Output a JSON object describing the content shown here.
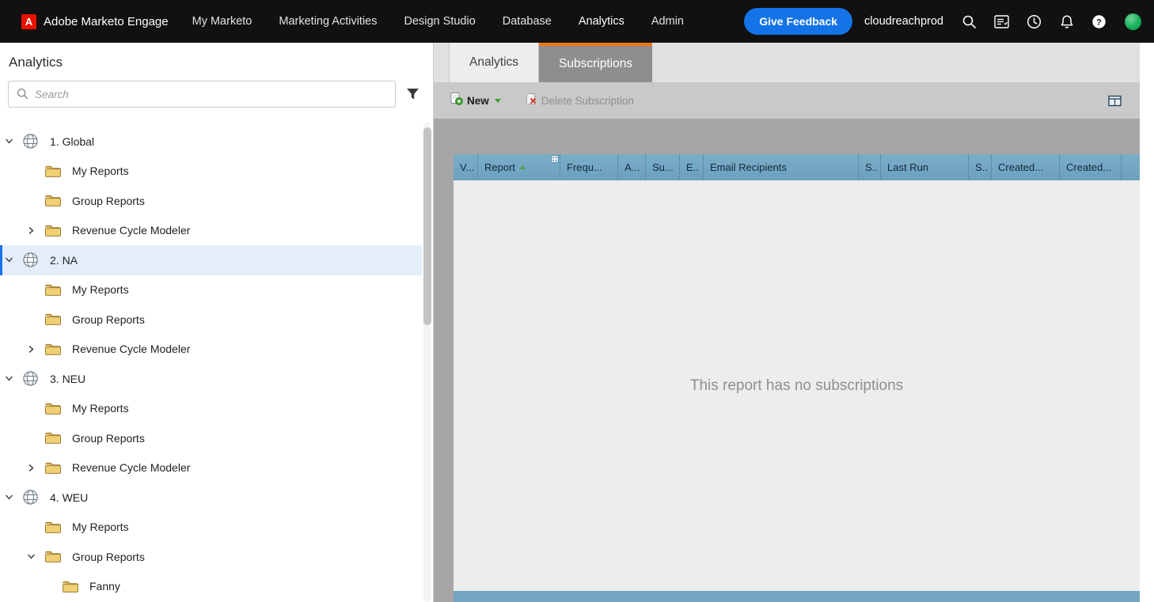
{
  "topbar": {
    "brand": "Adobe Marketo Engage",
    "nav": [
      {
        "label": "My Marketo",
        "active": false
      },
      {
        "label": "Marketing Activities",
        "active": false
      },
      {
        "label": "Design Studio",
        "active": false
      },
      {
        "label": "Database",
        "active": false
      },
      {
        "label": "Analytics",
        "active": true
      },
      {
        "label": "Admin",
        "active": false
      }
    ],
    "feedback_button": "Give Feedback",
    "account_name": "cloudreachprod",
    "icons": [
      "adobe-logo-icon",
      "search-icon",
      "form-icon",
      "clock-icon",
      "bell-icon",
      "help-icon",
      "avatar"
    ]
  },
  "sidebar": {
    "title": "Analytics",
    "search": {
      "placeholder": "Search"
    },
    "tree": [
      {
        "label": "1. Global",
        "icon": "workspace",
        "depth": 0,
        "state": "expanded",
        "selected": false
      },
      {
        "label": "My Reports",
        "icon": "folder",
        "depth": 1,
        "state": "none",
        "selected": false
      },
      {
        "label": "Group Reports",
        "icon": "folder",
        "depth": 1,
        "state": "none",
        "selected": false
      },
      {
        "label": "Revenue Cycle Modeler",
        "icon": "folder",
        "depth": 1,
        "state": "collapsed",
        "selected": false
      },
      {
        "label": "2. NA",
        "icon": "workspace",
        "depth": 0,
        "state": "expanded",
        "selected": true
      },
      {
        "label": "My Reports",
        "icon": "folder",
        "depth": 1,
        "state": "none",
        "selected": false
      },
      {
        "label": "Group Reports",
        "icon": "folder",
        "depth": 1,
        "state": "none",
        "selected": false
      },
      {
        "label": "Revenue Cycle Modeler",
        "icon": "folder",
        "depth": 1,
        "state": "collapsed",
        "selected": false
      },
      {
        "label": "3. NEU",
        "icon": "workspace",
        "depth": 0,
        "state": "expanded",
        "selected": false
      },
      {
        "label": "My Reports",
        "icon": "folder",
        "depth": 1,
        "state": "none",
        "selected": false
      },
      {
        "label": "Group Reports",
        "icon": "folder",
        "depth": 1,
        "state": "none",
        "selected": false
      },
      {
        "label": "Revenue Cycle Modeler",
        "icon": "folder",
        "depth": 1,
        "state": "collapsed",
        "selected": false
      },
      {
        "label": "4. WEU",
        "icon": "workspace",
        "depth": 0,
        "state": "expanded",
        "selected": false
      },
      {
        "label": "My Reports",
        "icon": "folder",
        "depth": 1,
        "state": "none",
        "selected": false
      },
      {
        "label": "Group Reports",
        "icon": "folder",
        "depth": 1,
        "state": "expanded",
        "selected": false
      },
      {
        "label": "Fanny",
        "icon": "folder",
        "depth": 2,
        "state": "none",
        "selected": false
      }
    ]
  },
  "main": {
    "tabs": [
      {
        "label": "Analytics",
        "active": false
      },
      {
        "label": "Subscriptions",
        "active": true
      }
    ],
    "toolbar": {
      "new_label": "New",
      "delete_label": "Delete Subscription",
      "delete_enabled": false
    },
    "table": {
      "columns": [
        {
          "label": "V..."
        },
        {
          "label": "Report",
          "sort": "asc",
          "menu": true
        },
        {
          "label": "Frequ..."
        },
        {
          "label": "A..."
        },
        {
          "label": "Su..."
        },
        {
          "label": "E..."
        },
        {
          "label": "Email Recipients"
        },
        {
          "label": "S..."
        },
        {
          "label": "Last Run"
        },
        {
          "label": "S..."
        },
        {
          "label": "Created..."
        },
        {
          "label": "Created..."
        }
      ],
      "empty_message": "This report has no subscriptions"
    }
  },
  "colors": {
    "accent_orange": "#f0780a",
    "feedback_blue": "#1473e6",
    "selection_blue": "#1473e6",
    "table_header_blue": "#73a6c3"
  }
}
